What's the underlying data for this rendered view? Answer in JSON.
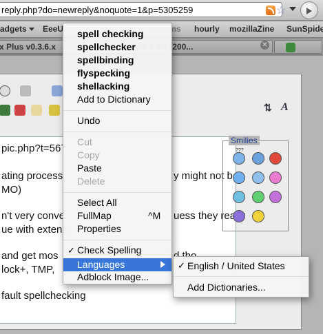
{
  "browser": {
    "url": "reply.php?do=newreply&noquote=1&p=5305259"
  },
  "bookmarks": {
    "items": [
      "adgets",
      "EeeU",
      "forums",
      "hourly",
      "mozillaZine",
      "SunSpider"
    ]
  },
  "tabs": [
    {
      "label": "x Plus v0.3.6.x"
    },
    {
      "label": "x Plus v0.3.6.x [200..."
    }
  ],
  "editor": {
    "lines": [
      "pic.php?t=567",
      "ating process",
      "MO)",
      "n't very conve",
      "ue with extens",
      "and get mos",
      "lock+, TMP,",
      "fault spellchecking"
    ],
    "right_fragments": [
      "y might not be",
      "uess they really",
      "d tho."
    ]
  },
  "smilies": {
    "title": "Smilies",
    "colors": [
      "#7db3e8",
      "#6aa0dc",
      "#e04a3a",
      "#6fb0f0",
      "#8fc0ee",
      "#e97bd0",
      "#6fc0e0",
      "#5fd070",
      "#c070d8",
      "#8a6fd8",
      "#f2d23a",
      "#000000"
    ],
    "top_label": "???"
  },
  "context_menu": {
    "suggestions": [
      "spell checking",
      "spellchecker",
      "spellbinding",
      "flyspecking",
      "shellacking"
    ],
    "add_to_dictionary": "Add to Dictionary",
    "undo": "Undo",
    "cut": "Cut",
    "copy": "Copy",
    "paste": "Paste",
    "delete": "Delete",
    "select_all": "Select All",
    "fullmap": "FullMap",
    "fullmap_shortcut": "^M",
    "properties": "Properties",
    "check_spelling": "Check Spelling",
    "check_mark": "✓",
    "languages": "Languages",
    "adblock_image": "Adblock Image..."
  },
  "languages_submenu": {
    "current": "English / United States",
    "check_mark": "✓",
    "add_dictionaries": "Add Dictionaries..."
  }
}
